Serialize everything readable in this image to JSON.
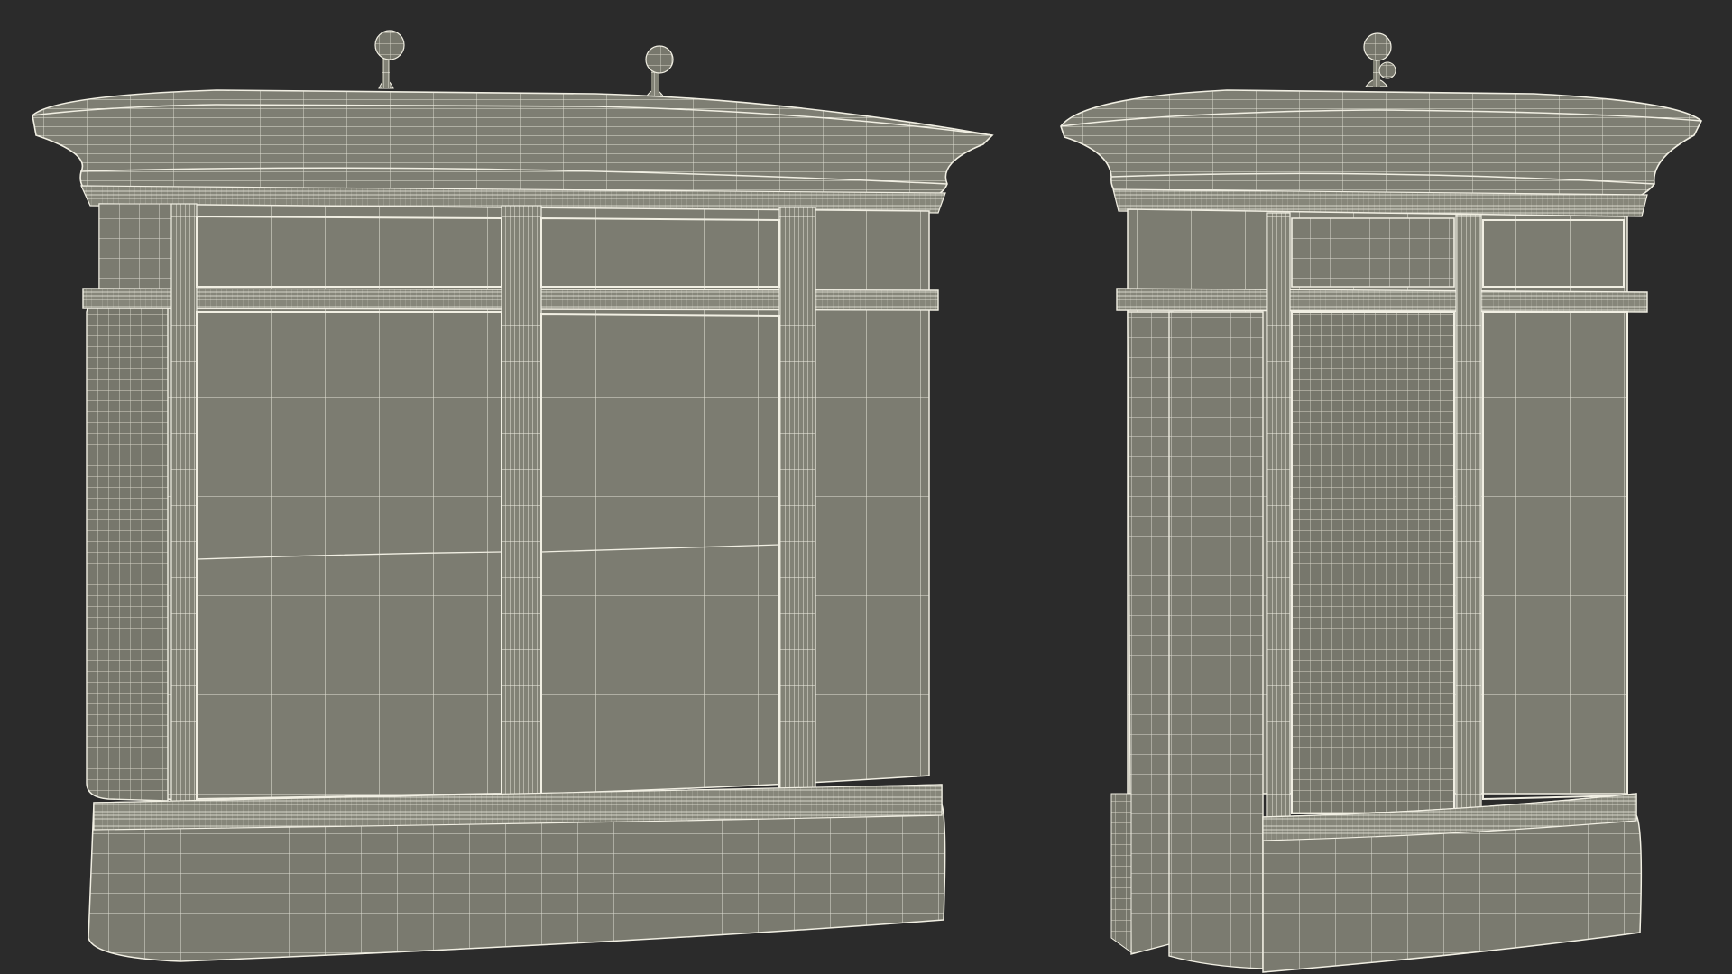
{
  "scene": {
    "background": "#2b2b2b",
    "mesh_fill": "#7b7b70",
    "mesh_fill_dark": "#6c6c62",
    "wire_color": "#f1efe3",
    "subjects": [
      {
        "name": "kiosk-front-three-quarter-view"
      },
      {
        "name": "kiosk-side-view"
      }
    ]
  }
}
